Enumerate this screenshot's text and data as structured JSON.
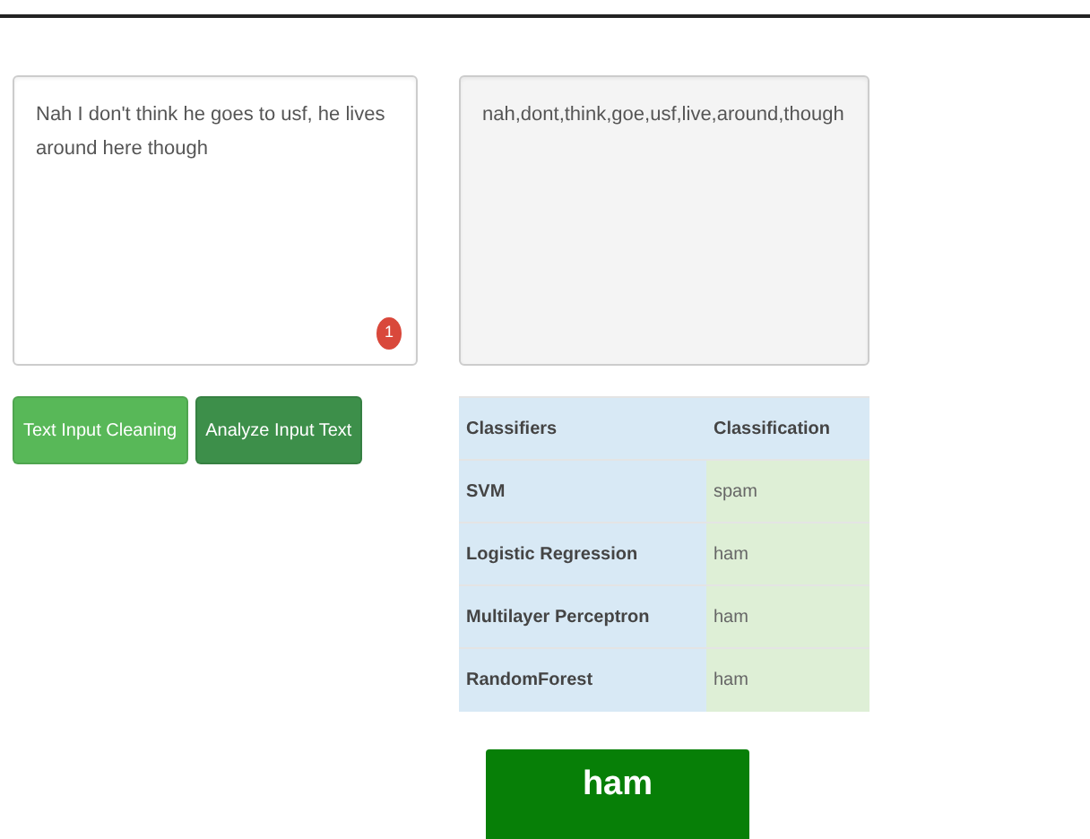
{
  "input": {
    "value": "Nah I don't think he goes to usf, he lives around here though",
    "badge": "1"
  },
  "cleaned": {
    "value": "nah,dont,think,goe,usf,live,around,though"
  },
  "buttons": [
    {
      "label": "Text Input Cleaning",
      "kind": "light"
    },
    {
      "label": "Analyze Input Text",
      "kind": "dark"
    }
  ],
  "table": {
    "columns": [
      "Classifiers",
      "Classification"
    ],
    "rows": [
      [
        "SVM",
        "spam"
      ],
      [
        "Logistic Regression",
        "ham"
      ],
      [
        "Multilayer Perceptron",
        "ham"
      ],
      [
        "RandomForest",
        "ham"
      ]
    ]
  },
  "result": {
    "label": "ham"
  }
}
